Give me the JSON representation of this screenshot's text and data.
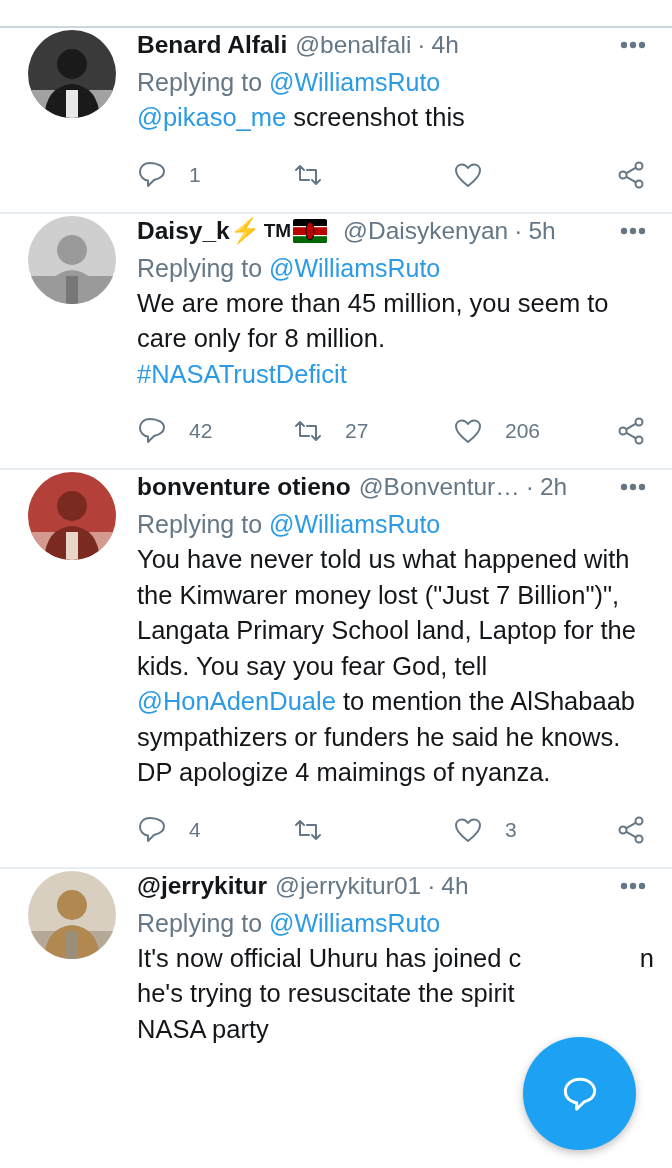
{
  "tweets": [
    {
      "name": "Benard Alfali",
      "handle": "@benalfali",
      "dot": "·",
      "time": "4h",
      "replying_label": "Replying to",
      "replying_to": "@WilliamsRuto",
      "body": [
        {
          "kind": "mention",
          "text": "@pikaso_me"
        },
        {
          "kind": "text",
          "text": " screenshot this"
        }
      ],
      "actions": {
        "reply_count": "1"
      }
    },
    {
      "name": "Daisy_k",
      "name_symbol": "⚡",
      "name_suffix": "TM",
      "flag": true,
      "handle": "@Daisykenyan",
      "dot": "·",
      "time": "5h",
      "replying_label": "Replying to",
      "replying_to": "@WilliamsRuto",
      "body": [
        {
          "kind": "text",
          "text": "We are more than 45 million, you seem to care only for 8 million.\n"
        },
        {
          "kind": "hashtag",
          "text": "#NASATrustDeficit"
        }
      ],
      "actions": {
        "reply_count": "42",
        "retweet_count": "27",
        "like_count": "206"
      }
    },
    {
      "name": "bonventure otieno",
      "handle": "@Bonventur…",
      "dot": "·",
      "time": "2h",
      "replying_label": "Replying to",
      "replying_to": "@WilliamsRuto",
      "body": [
        {
          "kind": "text",
          "text": "You have never told us what happened with the Kimwarer money lost (\"Just 7 Billion\")\", Langata Primary School land, Laptop for the kids. You say you fear God, tell "
        },
        {
          "kind": "mention",
          "text": "@HonAdenDuale"
        },
        {
          "kind": "text",
          "text": "  to mention the AlShabaab sympathizers or funders he said he knows. DP apologize 4 maimings of nyanza."
        }
      ],
      "actions": {
        "reply_count": "4",
        "like_count": "3"
      }
    },
    {
      "name": "@jerrykitur",
      "handle": "@jerrykitur01",
      "dot": "·",
      "time": "4h",
      "replying_label": "Replying to",
      "replying_to": "@WilliamsRuto",
      "body_lines": [
        "It's now official Uhuru has joined c",
        "he's trying to resuscitate the spirit",
        "NASA party"
      ],
      "covered_tail": "n"
    }
  ]
}
